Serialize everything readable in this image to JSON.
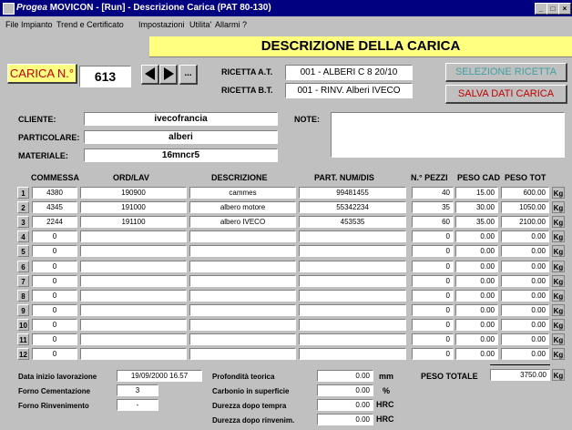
{
  "window": {
    "title_brand": "Progea",
    "title": "MOVICON - [Run] - Descrizione Carica (PAT 80-130)",
    "buttons": [
      "_",
      "□",
      "×"
    ]
  },
  "menu": [
    "File",
    "Impianto",
    "Trend e Certificato",
    "Impostazioni",
    "Utilita'",
    "Allarmi",
    "?"
  ],
  "header": {
    "title": "DESCRIZIONE DELLA CARICA"
  },
  "carica": {
    "label": "CARICA N.°",
    "value": "613",
    "more_label": "..."
  },
  "ricetta": {
    "at_label": "RICETTA A.T.",
    "at_value": "001 - ALBERI C 8 20/10",
    "bt_label": "RICETTA B.T.",
    "bt_value": "001 - RINV. Alberi IVECO"
  },
  "actions": {
    "select_label": "SELEZIONE RICETTA",
    "save_label": "SALVA DATI CARICA"
  },
  "info": {
    "cliente_label": "CLIENTE:",
    "cliente_value": "ivecofrancia",
    "particolare_label": "PARTICOLARE:",
    "particolare_value": "alberi",
    "materiale_label": "MATERIALE:",
    "materiale_value": "16mncr5",
    "note_label": "NOTE:",
    "note_value": ""
  },
  "table": {
    "headers": [
      "COMMESSA",
      "ORD/LAV",
      "DESCRIZIONE",
      "PART. NUM/DIS",
      "N.° PEZZI",
      "PESO CAD",
      "PESO TOT"
    ],
    "unit": "Kg",
    "rows": [
      {
        "n": "1",
        "commessa": "4380",
        "ordlav": "190900",
        "descrizione": "cammes",
        "partnum": "99481455",
        "pezzi": "40",
        "pesocad": "15.00",
        "pesotot": "600.00"
      },
      {
        "n": "2",
        "commessa": "4345",
        "ordlav": "191000",
        "descrizione": "albero motore",
        "partnum": "55342234",
        "pezzi": "35",
        "pesocad": "30.00",
        "pesotot": "1050.00"
      },
      {
        "n": "3",
        "commessa": "2244",
        "ordlav": "191100",
        "descrizione": "albero IVECO",
        "partnum": "453535",
        "pezzi": "60",
        "pesocad": "35.00",
        "pesotot": "2100.00"
      },
      {
        "n": "4",
        "commessa": "0",
        "ordlav": "",
        "descrizione": "",
        "partnum": "",
        "pezzi": "0",
        "pesocad": "0.00",
        "pesotot": "0.00"
      },
      {
        "n": "5",
        "commessa": "0",
        "ordlav": "",
        "descrizione": "",
        "partnum": "",
        "pezzi": "0",
        "pesocad": "0.00",
        "pesotot": "0.00"
      },
      {
        "n": "6",
        "commessa": "0",
        "ordlav": "",
        "descrizione": "",
        "partnum": "",
        "pezzi": "0",
        "pesocad": "0.00",
        "pesotot": "0.00"
      },
      {
        "n": "7",
        "commessa": "0",
        "ordlav": "",
        "descrizione": "",
        "partnum": "",
        "pezzi": "0",
        "pesocad": "0.00",
        "pesotot": "0.00"
      },
      {
        "n": "8",
        "commessa": "0",
        "ordlav": "",
        "descrizione": "",
        "partnum": "",
        "pezzi": "0",
        "pesocad": "0.00",
        "pesotot": "0.00"
      },
      {
        "n": "9",
        "commessa": "0",
        "ordlav": "",
        "descrizione": "",
        "partnum": "",
        "pezzi": "0",
        "pesocad": "0.00",
        "pesotot": "0.00"
      },
      {
        "n": "10",
        "commessa": "0",
        "ordlav": "",
        "descrizione": "",
        "partnum": "",
        "pezzi": "0",
        "pesocad": "0.00",
        "pesotot": "0.00"
      },
      {
        "n": "11",
        "commessa": "0",
        "ordlav": "",
        "descrizione": "",
        "partnum": "",
        "pezzi": "0",
        "pesocad": "0.00",
        "pesotot": "0.00"
      },
      {
        "n": "12",
        "commessa": "0",
        "ordlav": "",
        "descrizione": "",
        "partnum": "",
        "pezzi": "0",
        "pesocad": "0.00",
        "pesotot": "0.00"
      }
    ]
  },
  "bottom": {
    "data_inizio_label": "Data inizio lavorazione",
    "data_inizio_value": "19/09/2000 16.57",
    "forno_cem_label": "Forno Cementazione",
    "forno_cem_value": "3",
    "forno_rinv_label": "Forno Rinvenimento",
    "forno_rinv_value": "-",
    "profondita_label": "Profondità teorica",
    "profondita_value": "0.00",
    "profondita_unit": "mm",
    "carbonio_label": "Carbonio in superficie",
    "carbonio_value": "0.00",
    "carbonio_unit": "%",
    "durezza_tempra_label": "Durezza dopo tempra",
    "durezza_tempra_value": "0.00",
    "durezza_tempra_unit": "HRC",
    "durezza_rinv_label": "Durezza dopo rinvenim.",
    "durezza_rinv_value": "0.00",
    "durezza_rinv_unit": "HRC",
    "peso_totale_label": "PESO TOTALE",
    "peso_totale_value": "3750.00",
    "peso_totale_unit": "Kg"
  },
  "colors": {
    "title_bar": "#000080",
    "header_bg": "#ffff80",
    "carica_bg": "#ffff80",
    "carica_text": "#c00000",
    "save_text": "#c00000",
    "select_text": "#40a0a0"
  }
}
